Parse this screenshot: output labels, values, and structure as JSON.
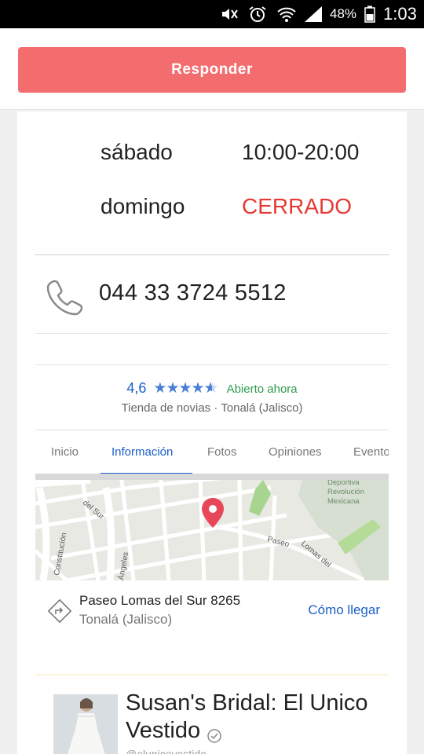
{
  "status_bar": {
    "battery": "48%",
    "time": "1:03",
    "icons": [
      "mute-icon",
      "alarm-icon",
      "wifi-icon",
      "signal-icon",
      "battery-icon"
    ]
  },
  "top_bar": {
    "reply_label": "Responder",
    "reply_color": "#f36d6f"
  },
  "hours": [
    {
      "day": "sábado",
      "time": "10:00-20:00",
      "closed": false
    },
    {
      "day": "domingo",
      "time": "CERRADO",
      "closed": true
    }
  ],
  "phone": {
    "number": "044 33 3724 5512",
    "icon": "phone-icon"
  },
  "knowledge_panel": {
    "rating": "4,6",
    "stars": 4.6,
    "status": "Abierto ahora",
    "category": "Tienda de novias",
    "location": "Tonalá (Jalisco)",
    "tabs": [
      "Inicio",
      "Información",
      "Fotos",
      "Opiniones",
      "Evento"
    ],
    "active_tab": "Información",
    "map_labels": {
      "street1": "del Sur",
      "street2": "Constitución",
      "street3": "Ángeles",
      "street4": "Paseo",
      "street5": "Lomas del",
      "park": "Deportiva Revolución Mexicana"
    },
    "address_line1": "Paseo Lomas del Sur 8265",
    "address_line2": "Tonalá (Jalisco)",
    "directions_label": "Cómo llegar"
  },
  "post": {
    "title": "Susan's Bridal: El Unico Vestido",
    "handle": "@elunicovestido"
  },
  "colors": {
    "accent_blue": "#1a5fc6",
    "closed_red": "#e53935",
    "open_green": "#2e9b4b",
    "pin_red": "#e8475a"
  }
}
